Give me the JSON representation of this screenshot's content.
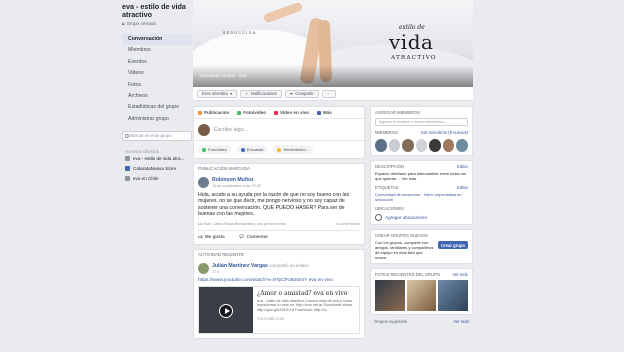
{
  "group": {
    "title": "eva - estilo de vida atractivo",
    "privacy": "Grupo cerrado"
  },
  "sidebar": {
    "items": [
      {
        "label": "Conversación",
        "active": true
      },
      {
        "label": "Miembros"
      },
      {
        "label": "Eventos"
      },
      {
        "label": "Videos"
      },
      {
        "label": "Fotos"
      },
      {
        "label": "Archivos"
      },
      {
        "label": "Estadísticas del grupo"
      },
      {
        "label": "Administrar grupo"
      }
    ],
    "search_placeholder": "Buscar en este grupo",
    "shortcuts_title": "Accesos directos",
    "shortcuts": [
      {
        "label": "eva - estilo de vida atra..."
      },
      {
        "label": "CatarataNueva Store"
      },
      {
        "label": "eva en Chile"
      }
    ]
  },
  "cover": {
    "side_text": "SEDUCCIÓN",
    "brand_small": "estilo de",
    "brand_big": "vida",
    "brand_sub": "ATRACTIVO",
    "caption": "Vinculado Grupo · eva"
  },
  "actions": {
    "member": "Eres miembro",
    "notifications": "Notificaciones",
    "share": "Compartir",
    "more": "···"
  },
  "composer": {
    "tabs": [
      "Publicación",
      "Foto/video",
      "Video en vivo",
      "Más"
    ],
    "placeholder": "Escribe algo...",
    "buttons": [
      "Foto/video",
      "Encuesta",
      "Sentimiento/..."
    ]
  },
  "pinned": {
    "label": "PUBLICACIÓN MARCADA",
    "author": "Robinson Muñoz",
    "meta": "10 de septiembre a las 20:43",
    "text": "Hola, acudo a su ayuda por la razón de que no soy bueno con las mujeres, no se que decir, me pongo nervioso y no soy capaz de sostener una conversación. QUE PUEDO HASER? Para ser de buenas con las mujeres.",
    "reactions": "Juan Carlos Rivas Benavides y una persona más",
    "comments": "4 comentarios",
    "like": "Me gusta",
    "comment": "Comentar"
  },
  "recent": {
    "label": "ACTIVIDAD RECIENTE",
    "author": "Julián Martínez Vargas",
    "action": "compartió un enlace.",
    "meta": "17 h",
    "url": "https://www.youtube.com/watch?v=9TpCPoBaOmY eva en vivo",
    "preview_title": "¿Amor o amistad? eva en vivo",
    "preview_desc": "eva - estilo de vida atractivo Conoce más de eva y cómo transformar tu vida en: http://eva.net.ar Suscríbete ahora http://goo.gl/UGKZrI ● Facebook: http://w...",
    "preview_domain": "YOUTUBE.COM"
  },
  "right": {
    "add_members_title": "AGREGAR MIEMBROS",
    "add_members_placeholder": "Ingresa el nombre o correo electrónico...",
    "members_title": "MIEMBROS",
    "members_count": "416 miembros (9 nuevos)",
    "description_title": "DESCRIPCIÓN",
    "edit": "Editar",
    "description_text": "Espacio diseñado para intercambiar entre todos los que quieran ... Ver más",
    "tags_title": "ETIQUETAS",
    "tags_text": "Comunidad de seducción · Hitch: especialista en seducción",
    "locations_title": "UBICACIONES",
    "add_location": "Agregar ubicaciones",
    "create_title": "CREAR GRUPOS NUEVOS",
    "create_text": "Con los grupos, compartir con amigos, familiares y compañeros de equipo es más fácil que nunca.",
    "create_button": "Crear grupo",
    "photos_title": "FOTOS RECIENTES DEL GRUPO",
    "see_all": "Ver todo",
    "suggested_title": "Grupos sugeridos"
  },
  "colors": {
    "link": "#365899",
    "primary": "#4267b2",
    "background": "#e9ebee"
  }
}
